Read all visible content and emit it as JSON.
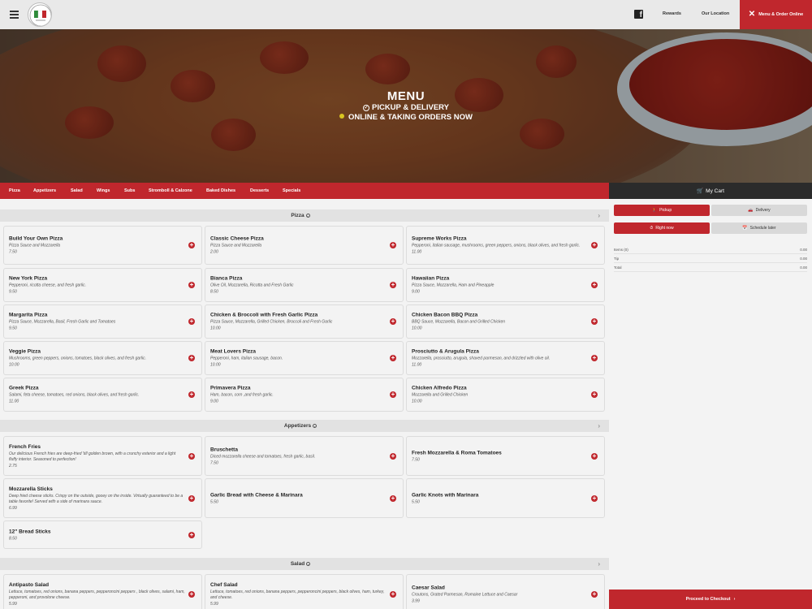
{
  "header": {
    "nav": [
      "Rewards",
      "Our Location"
    ],
    "order_button": "Menu & Order Online"
  },
  "hero": {
    "title": "MENU",
    "line1": "PICKUP & DELIVERY",
    "line2": "ONLINE & TAKING ORDERS NOW"
  },
  "categories": [
    "Pizza",
    "Appetizers",
    "Salad",
    "Wings",
    "Subs",
    "Stromboll & Calzone",
    "Baked Dishes",
    "Desserts",
    "Specials"
  ],
  "cart": {
    "title": "My Cart",
    "pickup": "Pickup",
    "delivery": "Delivery",
    "right_now": "Right now",
    "schedule_later": "Schedule later",
    "items_label": "Items (0)",
    "items_value": "0.00",
    "tip_label": "Tip",
    "tip_value": "0.00",
    "total_label": "Total",
    "total_value": "0.00",
    "checkout": "Proceed to Checkout"
  },
  "sections": [
    {
      "title": "Pizza",
      "items": [
        {
          "name": "Build Your Own Pizza",
          "desc": "Pizza Sauce and Mozzarella",
          "price": "7.50"
        },
        {
          "name": "Classic Cheese Pizza",
          "desc": "Pizza Sauce and Mozzarella",
          "price": "2.00"
        },
        {
          "name": "Supreme Works Pizza",
          "desc": "Pepperoni, italian sausage, mushrooms, green peppers, onions, black olives, and fresh garlic.",
          "price": "11.00"
        },
        {
          "name": "New York Pizza",
          "desc": "Pepperoni, ricotta cheese, and fresh garlic.",
          "price": "9.50"
        },
        {
          "name": "Bianca Pizza",
          "desc": "Olive Oil, Mozzarella, Ricotta and Fresh Garlic",
          "price": "8.50"
        },
        {
          "name": "Hawaiian Pizza",
          "desc": "Pizza Sauce, Mozzarella, Ham and Pineapple",
          "price": "9.00"
        },
        {
          "name": "Margarita Pizza",
          "desc": "Pizza Sauce, Mozzarella, Basil, Fresh Garlic and Tomatoes",
          "price": "9.50"
        },
        {
          "name": "Chicken & Broccoli with Fresh Garlic Pizza",
          "desc": "Pizza Sauce, Mozzarella, Grilled Chicken, Broccoli and Fresh Garlic",
          "price": "10.00"
        },
        {
          "name": "Chicken Bacon BBQ Pizza",
          "desc": "BBQ Sauce, Mozzarella, Bacon and Grilled Chicken",
          "price": "10.00"
        },
        {
          "name": "Veggie Pizza",
          "desc": "Mushrooms, green peppers, onions, tomatoes, black olives, and fresh garlic.",
          "price": "10.00"
        },
        {
          "name": "Meat Lovers Pizza",
          "desc": "Pepperoni, ham, italian sausage, bacon.",
          "price": "10.00"
        },
        {
          "name": "Prosciutto & Arugula Pizza",
          "desc": "Mozzarella, prosciutto, arugula, shaved parmesan, and drizzled with olive oil.",
          "price": "11.00"
        },
        {
          "name": "Greek Pizza",
          "desc": "Salami, feta cheese, tomatoes, red onions, black olives, and fresh garlic.",
          "price": "11.00"
        },
        {
          "name": "Primavera Pizza",
          "desc": "Ham, bacon, corn ,and fresh garlic.",
          "price": "9.00"
        },
        {
          "name": "Chicken Alfredo Pizza",
          "desc": "Mozzarella and Grilled Chicken",
          "price": "10.00"
        }
      ]
    },
    {
      "title": "Appetizers",
      "items": [
        {
          "name": "French Fries",
          "desc": "Our delicious French fries are deep-fried 'till golden brown, with a crunchy exterior and a light fluffy interior. Seasoned to perfection!",
          "price": "2.75"
        },
        {
          "name": "Bruschetta",
          "desc": "Diced mozzarella cheese and tomatoes, fresh garlic, basil.",
          "price": "7.50"
        },
        {
          "name": "Fresh Mozzarella & Roma Tomatoes",
          "desc": "",
          "price": "7.50"
        },
        {
          "name": "Mozzarella Sticks",
          "desc": "Deep fried cheese sticks. Crispy on the outside, gooey on the inside. Virtually guaranteed to be a table favorite! Served with a side of marinara sauce.",
          "price": "6.99"
        },
        {
          "name": "Garlic Bread with Cheese & Marinara",
          "desc": "",
          "price": "5.50"
        },
        {
          "name": "Garlic Knots with Marinara",
          "desc": "",
          "price": "5.50"
        },
        {
          "name": "12\" Bread Sticks",
          "desc": "",
          "price": "8.50"
        }
      ]
    },
    {
      "title": "Salad",
      "items": [
        {
          "name": "Antipasto Salad",
          "desc": "Lettuce, tomatoes, red onions, banana peppers, pepperoncini peppers , black olives, salami, ham, pepperoni, and provolone cheese.",
          "price": "5.99"
        },
        {
          "name": "Chef Salad",
          "desc": "Lettuce, tomatoes, red onions, banana peppers, pepperoncini peppers, black olives, ham, turkey, and cheese.",
          "price": "5.99"
        },
        {
          "name": "Caesar Salad",
          "desc": "Croutons, Grated Parmesan, Romaine Lettuce and Caesar",
          "price": "3.99"
        }
      ]
    }
  ]
}
